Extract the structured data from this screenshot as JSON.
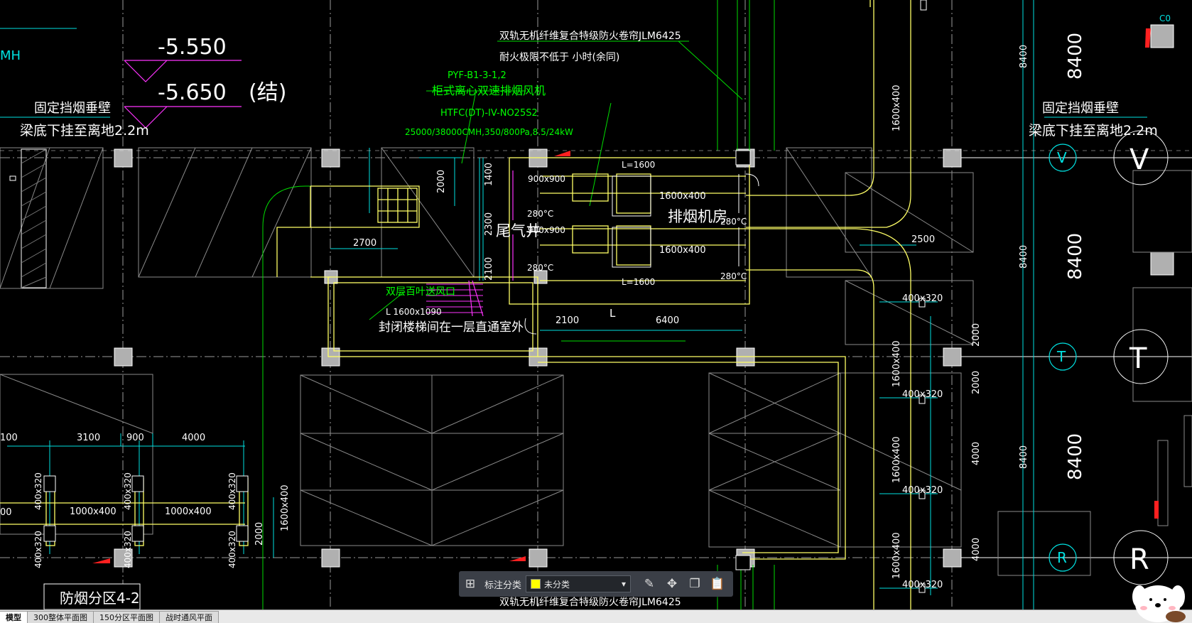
{
  "drawing": {
    "elevation_1": "-5.550",
    "elevation_2": "-5.650",
    "elevation_note": "(结)",
    "left_top_fragment": "MH",
    "smoke_wall_left_1": "固定挡烟垂壁",
    "smoke_wall_left_2": "梁底下挂至离地2.2m",
    "smoke_wall_right_1": "固定挡烟垂壁",
    "smoke_wall_right_2": "梁底下挂至离地2.2m",
    "curtain_top_1": "双轨无机纤维复合特级防火卷帘JLM6425",
    "curtain_top_2": "耐火极限不低于 小时(余同)",
    "curtain_bottom": "双轨无机纤维复合特级防火卷帘JLM6425",
    "fan_code": "PYF-B1-3-1,2",
    "fan_name": "柜式离心双速排烟风机",
    "fan_model": "HTFC(DT)-IV-NO25S2",
    "fan_spec": "25000/38000CMH,350/800Pa,8.5/24kW",
    "duct_900a": "900x900",
    "duct_900b": "900x900",
    "duct_1600a": "1600x400",
    "duct_1600b": "1600x400",
    "l1600_top": "L=1600",
    "l1600_bot": "L=1600",
    "t280_1": "280°C",
    "t280_2": "280°C",
    "t280_3": "280°C",
    "t280_4": "280°C",
    "room_name": "排烟机房",
    "shaft_name": "尾气井",
    "louver_1": "双层百叶送风口",
    "louver_2": "L 1600x1090",
    "stair_note": "封闭楼梯间在一层直通室外",
    "dim_2700": "2700",
    "dim_2100": "2100",
    "dim_6400": "6400",
    "dim_2500": "2500",
    "dim_1400": "1400",
    "dim_2300": "2300",
    "dim_2100v": "2100",
    "dim_2000a": "2000",
    "dim_2000b": "2000",
    "dim_3100": "3100",
    "dim_900": "900",
    "dim_4000": "4000",
    "dim_100": "100",
    "dim_00": "00",
    "dim_2000v1": "2000",
    "dim_2000v2": "2000",
    "dim_4000v1": "4000",
    "dim_4000v2": "4000",
    "dim_2000left": "2000",
    "dim_8400_s1": "8400",
    "dim_8400_s2": "8400",
    "dim_8400_s3": "8400",
    "dim_8400_b1": "8400",
    "dim_8400_b2": "8400",
    "dim_8400_b3": "8400",
    "duct_1600x400_v1": "1600x400",
    "duct_1600x400_v2": "1600x400",
    "duct_1600x400_v3": "1600x400",
    "duct_1600x400_v4": "1600x400",
    "duct_1600x400_v5": "1600x400",
    "duct_1600x400_l": "1600x400",
    "duct_1000a": "1000x400",
    "duct_1000b": "1000x400",
    "duct_400_1": "400x320",
    "duct_400_2": "400x320",
    "duct_400_3": "400x320",
    "duct_400_4": "400x320",
    "duct_400_5": "400x320",
    "duct_400_6": "400x320",
    "duct_400_7": "400x320",
    "duct_400_8": "400x320",
    "duct_400_r1": "400x320",
    "duct_400_r2": "400x320",
    "duct_400_r3": "400x320",
    "duct_400_r4": "400x320",
    "zone_label": "防烟分区4-2",
    "axis_v": "V",
    "axis_t": "T",
    "axis_r": "R",
    "corner_tag": "C0",
    "l_mark": "L"
  },
  "toolbar": {
    "grid_icon": "grid-icon",
    "label": "标注分类",
    "selected": "未分类",
    "swatch_color": "#ffff00"
  },
  "tabs": [
    "模型",
    "300整体平面图",
    "150分区平面图",
    "战时通风平面"
  ],
  "active_tab": "模型",
  "colors": {
    "background": "#000000",
    "duct_yellow": "#ffff66",
    "green": "#00ff00",
    "cyan": "#00ffff",
    "white": "#ffffff",
    "magenta": "#ff00ff",
    "gray": "#808080"
  }
}
